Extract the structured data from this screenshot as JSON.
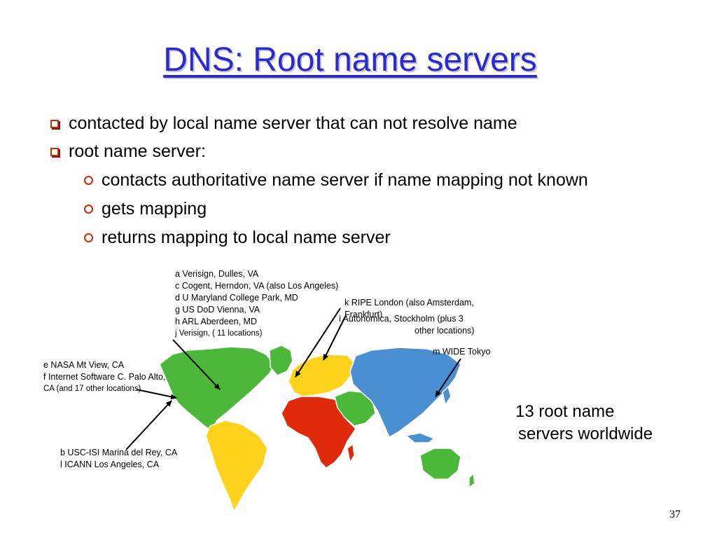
{
  "slide": {
    "title": "DNS: Root name servers",
    "bullets": [
      "contacted by local name server that can not resolve name",
      "root name server:"
    ],
    "sub_bullets": [
      "contacts authoritative name server if name mapping not known",
      "gets mapping",
      "returns mapping to local name server"
    ],
    "page_number": "37"
  },
  "map": {
    "labels": {
      "us_east": [
        "a Verisign, Dulles, VA",
        "c Cogent, Herndon, VA (also Los Angeles)",
        "d U Maryland College Park, MD",
        "g US DoD Vienna, VA",
        "h ARL Aberdeen, MD",
        "j  Verisign, ( 11 locations)"
      ],
      "europe_k": [
        "k RIPE London (also Amsterdam,",
        "Frankfurt)"
      ],
      "europe_i": [
        "i Autonomica, Stockholm (plus 3",
        "other locations)"
      ],
      "tokyo": "m WIDE Tokyo",
      "us_west": [
        "e NASA Mt View, CA",
        "f  Internet Software C. Palo Alto,",
        "CA (and 17 other locations)"
      ],
      "la": [
        "b USC-ISI Marina del Rey, CA",
        "l  ICANN Los Angeles, CA"
      ]
    },
    "summary": [
      "13 root name",
      "servers worldwide"
    ],
    "colors": {
      "north_america": "#4bb83a",
      "south_america": "#ffd21c",
      "europe": "#ffd21c",
      "africa": "#de2a0a",
      "asia": "#4a8fd2",
      "middle_east": "#4bb83a",
      "australia": "#4bb83a",
      "title": "#2a2ad0",
      "bullet": "#c62a08"
    }
  }
}
